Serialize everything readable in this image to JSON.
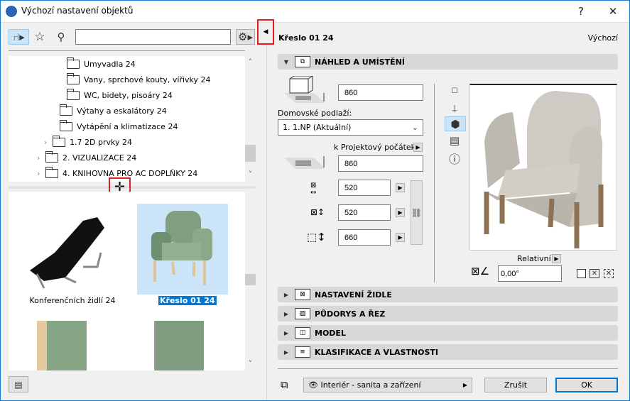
{
  "window": {
    "title": "Výchozí nastavení objektů",
    "help": "?",
    "close": "✕"
  },
  "toolbar": {
    "search_value": "",
    "search_placeholder": ""
  },
  "tree": {
    "items": [
      {
        "label": "Umyvadla 24",
        "depth": 3,
        "expandable": false
      },
      {
        "label": "Vany, sprchové kouty, vířivky 24",
        "depth": 3,
        "expandable": false
      },
      {
        "label": "WC, bidety, pisoáry 24",
        "depth": 3,
        "expandable": false
      },
      {
        "label": "Výtahy a eskalátory 24",
        "depth": 2,
        "expandable": false
      },
      {
        "label": "Vytápění a klimatizace 24",
        "depth": 2,
        "expandable": false
      },
      {
        "label": "1.7 2D prvky 24",
        "depth": 1,
        "expandable": true
      },
      {
        "label": "2. VIZUALIZACE 24",
        "depth": 0,
        "expandable": true
      },
      {
        "label": "4. KNIHOVNA PRO AC DOPLŇKY 24",
        "depth": 0,
        "expandable": true
      }
    ]
  },
  "thumbnails": [
    {
      "label": "Konferenčních židlí 24",
      "selected": false
    },
    {
      "label": "Křeslo 01 24",
      "selected": true
    }
  ],
  "header": {
    "object_name": "Křeslo 01 24",
    "default_label": "Výchozí"
  },
  "preview_section": {
    "title": "NÁHLED A UMÍSTĚNÍ",
    "elevation": "860",
    "home_story_label": "Domovské podlaží:",
    "home_story_value": "1. 1.NP (Aktuální)",
    "reference_label": "k Projektový počátek",
    "reference_value": "860",
    "width": "520",
    "depth": "520",
    "height": "660",
    "orientation_label": "Relativní",
    "angle": "0,00°"
  },
  "sections": [
    {
      "title": "NASTAVENÍ ŽIDLE",
      "icon": "chair-settings-icon"
    },
    {
      "title": "PŮDORYS A ŘEZ",
      "icon": "floorplan-section-icon"
    },
    {
      "title": "MODEL",
      "icon": "model-cube-icon"
    },
    {
      "title": "KLASIFIKACE A VLASTNOSTI",
      "icon": "document-icon"
    }
  ],
  "footer": {
    "layer": "Interiér - sanita a zařízení",
    "cancel": "Zrušit",
    "ok": "OK"
  },
  "colors": {
    "accent": "#0078d7",
    "highlight": "#cce4f7",
    "annotation": "#e51c23"
  }
}
